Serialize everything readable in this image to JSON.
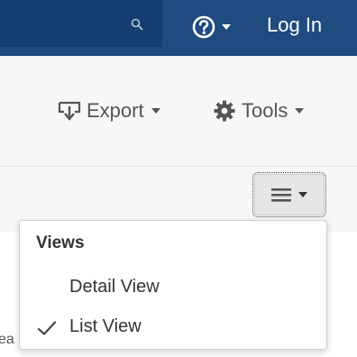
{
  "navbar": {
    "background": "#1f4b80",
    "search_icon": "search-icon",
    "help_icon": "question-circle-icon",
    "login_label": "Log In"
  },
  "toolbar": {
    "export_label": "Export",
    "export_icon": "export-icon",
    "tools_label": "Tools",
    "tools_icon": "gear-icon"
  },
  "view_menu": {
    "toggle_icon": "hamburger-icon",
    "header": "Views",
    "items": [
      {
        "label": "Detail View",
        "checked": false
      },
      {
        "label": "List View",
        "checked": true
      }
    ]
  },
  "background_text": "ea"
}
